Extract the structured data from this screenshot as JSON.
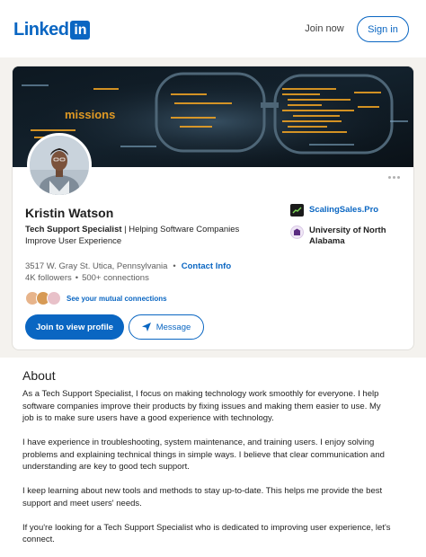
{
  "header": {
    "logo_text": "Linked",
    "logo_box_text": "in",
    "join_now_label": "Join now",
    "sign_in_label": "Sign in"
  },
  "profile": {
    "banner_text": "missions",
    "name": "Kristin Watson",
    "headline_bold": "Tech Support Specialist",
    "headline_rest": " | Helping Software Companies Improve User Experience",
    "location": "3517 W. Gray St. Utica, Pennsylvania",
    "contact_info_label": "Contact Info",
    "followers": "4K followers",
    "connections": "500+ connections",
    "mutual_label": "See your mutual connections",
    "join_button_label": "Join to view profile",
    "message_button_label": "Message",
    "companies": [
      {
        "name": "ScalingSales.Pro",
        "icon": "company-logo-icon"
      },
      {
        "name": "University of North Alabama",
        "icon": "university-logo-icon"
      }
    ]
  },
  "about": {
    "title": "About",
    "paragraphs": [
      "As a Tech Support Specialist, I focus on making technology work smoothly for everyone. I help software companies improve their products by fixing issues and making them easier to use. My job is to make sure users have a good experience with technology.",
      "I have experience in troubleshooting, system maintenance, and training users. I enjoy solving problems and explaining technical things in simple ways. I believe that clear communication and understanding are key to good tech support.",
      "I keep learning about new tools and methods to stay up-to-date. This helps me provide the best support and meet users' needs.",
      "If you're looking for a Tech Support Specialist who is dedicated to improving user experience, let's connect."
    ]
  },
  "colors": {
    "brand": "#0a66c2",
    "page_bg": "#f4f2ee",
    "banner_accent": "#f5a623"
  }
}
